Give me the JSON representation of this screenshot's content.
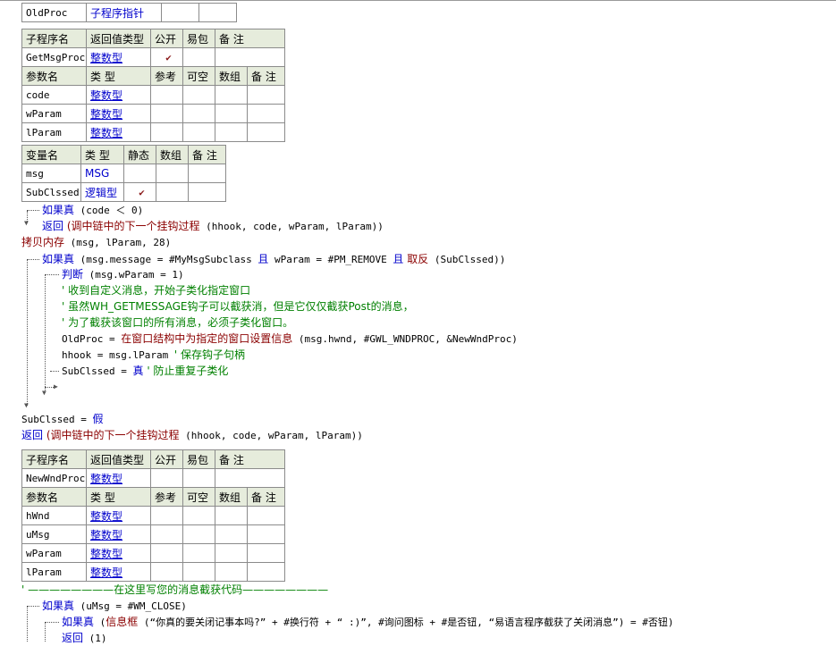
{
  "var_table_top": {
    "name": "OldProc",
    "type": "子程序指针"
  },
  "sub1": {
    "headers": [
      "子程序名",
      "返回值类型",
      "公开",
      "易包",
      "备 注"
    ],
    "name": "GetMsgProc",
    "ret": "整数型",
    "public_check": "✔",
    "param_headers": [
      "参数名",
      "类 型",
      "参考",
      "可空",
      "数组",
      "备 注"
    ],
    "params": [
      {
        "name": "code",
        "type": "整数型"
      },
      {
        "name": "wParam",
        "type": "整数型"
      },
      {
        "name": "lParam",
        "type": "整数型"
      }
    ]
  },
  "locals1": {
    "headers": [
      "变量名",
      "类 型",
      "静态",
      "数组",
      "备 注"
    ],
    "rows": [
      {
        "name": "msg",
        "type": "MSG",
        "static": ""
      },
      {
        "name": "SubClssed",
        "type": "逻辑型",
        "static": "✔"
      }
    ]
  },
  "code1": {
    "l1_kw": "如果真",
    "l1_rest": " (code ＜ 0)",
    "l2_kw": "返回",
    "l2_fn": " (调中链中的下一个挂钩过程",
    "l2_rest": " (hhook, code, wParam, lParam))",
    "l3_fn": "拷贝内存",
    "l3_rest": " (msg, lParam, 28)",
    "l4_kw": "如果真",
    "l4_a": " (msg.message = #MyMsgSubclass ",
    "l4_and1": "且",
    "l4_b": " wParam = #PM_REMOVE ",
    "l4_and2": "且",
    "l4_not": " 取反",
    "l4_c": " (SubClssed))",
    "l5_kw": "判断",
    "l5_rest": " (msg.wParam = 1)",
    "l6": "' 收到自定义消息，开始子类化指定窗口",
    "l7": "' 虽然WH_GETMESSAGE钩子可以截获消，但是它仅仅截获Post的消息，",
    "l8": "' 为了截获该窗口的所有消息，必须子类化窗口。",
    "l9_a": "OldProc = ",
    "l9_fn": "在窗口结构中为指定的窗口设置信息",
    "l9_b": " (msg.hwnd, #GWL_WNDPROC, &NewWndProc)",
    "l10_a": "hhook = msg.lParam  ",
    "l10_cm": "' 保存钩子句柄",
    "l11_a": "SubClssed = ",
    "l11_kw": "真",
    "l11_cm": "  ' 防止重复子类化",
    "l12_a": "SubClssed = ",
    "l12_kw": "假",
    "l13_kw": "返回",
    "l13_fn": " (调中链中的下一个挂钩过程",
    "l13_rest": " (hhook, code, wParam, lParam))"
  },
  "sub2": {
    "headers": [
      "子程序名",
      "返回值类型",
      "公开",
      "易包",
      "备 注"
    ],
    "name": "NewWndProc",
    "ret": "整数型",
    "param_headers": [
      "参数名",
      "类 型",
      "参考",
      "可空",
      "数组",
      "备 注"
    ],
    "params": [
      {
        "name": "hWnd",
        "type": "整数型"
      },
      {
        "name": "uMsg",
        "type": "整数型"
      },
      {
        "name": "wParam",
        "type": "整数型"
      },
      {
        "name": "lParam",
        "type": "整数型"
      }
    ]
  },
  "code2": {
    "l1": "' ————————在这里写您的消息截获代码————————",
    "l2_kw": "如果真",
    "l2_rest": " (uMsg = #WM_CLOSE)",
    "l3_kw": "如果真",
    "l3_a": " (",
    "l3_fn": "信息框",
    "l3_b": " (“你真的要关闭记事本吗?” + #换行符 + “      :)”, #询问图标 + #是否钮, “易语言程序截获了关闭消息”) = #否钮)",
    "l4_kw": "返回",
    "l4_rest": " (1)"
  }
}
